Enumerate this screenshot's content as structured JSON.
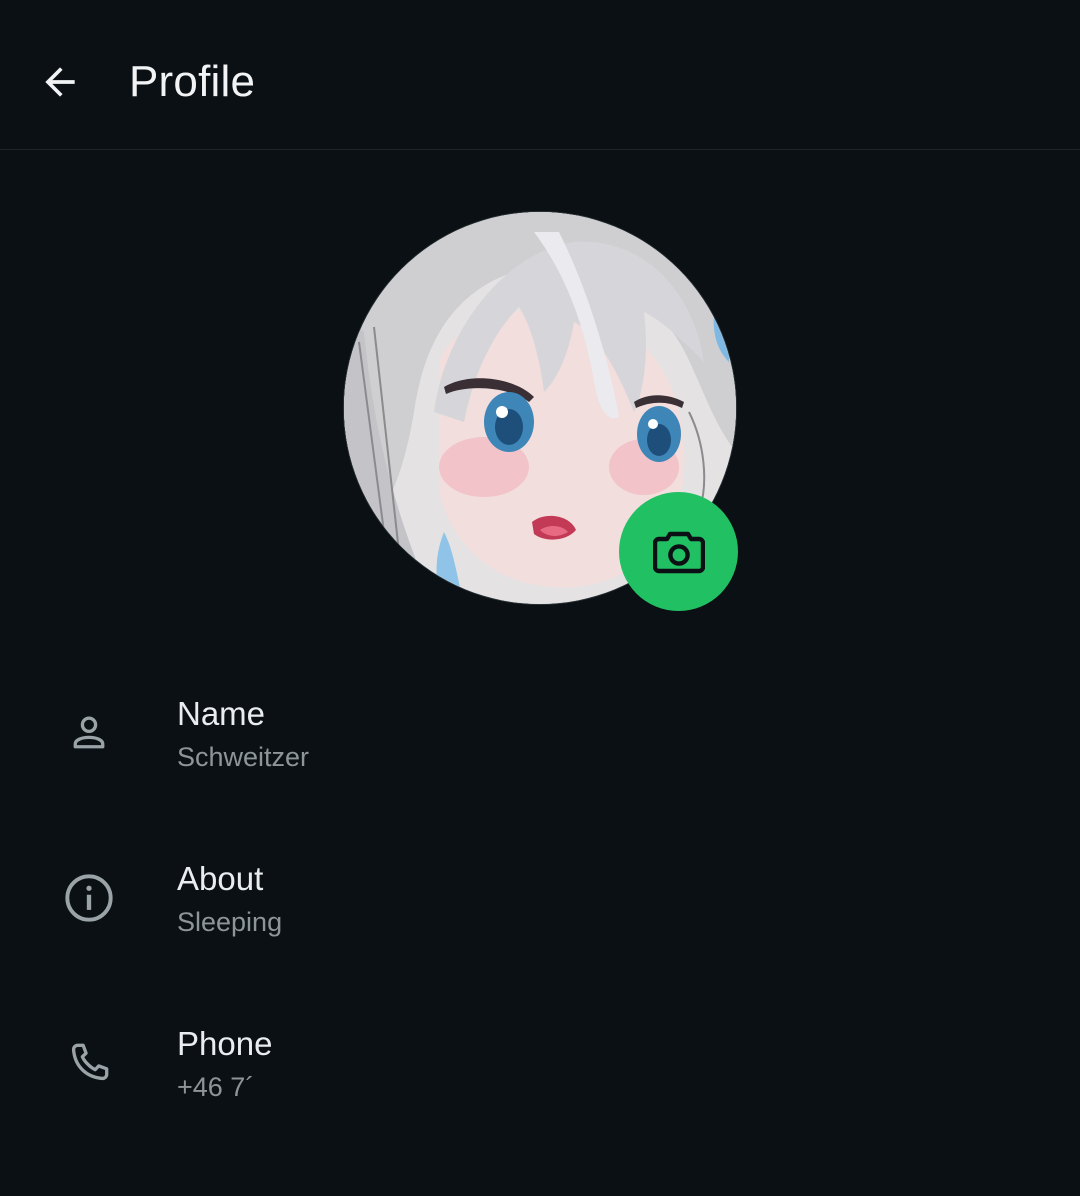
{
  "header": {
    "title": "Profile",
    "back_icon": "arrow-left-icon"
  },
  "avatar": {
    "edit_icon": "camera-icon",
    "edit_color": "#21c063"
  },
  "rows": [
    {
      "icon": "person-icon",
      "label": "Name",
      "value": "Schweitzer"
    },
    {
      "icon": "info-icon",
      "label": "About",
      "value": "Sleeping"
    },
    {
      "icon": "phone-icon",
      "label": "Phone",
      "value": "+46 7´"
    }
  ]
}
